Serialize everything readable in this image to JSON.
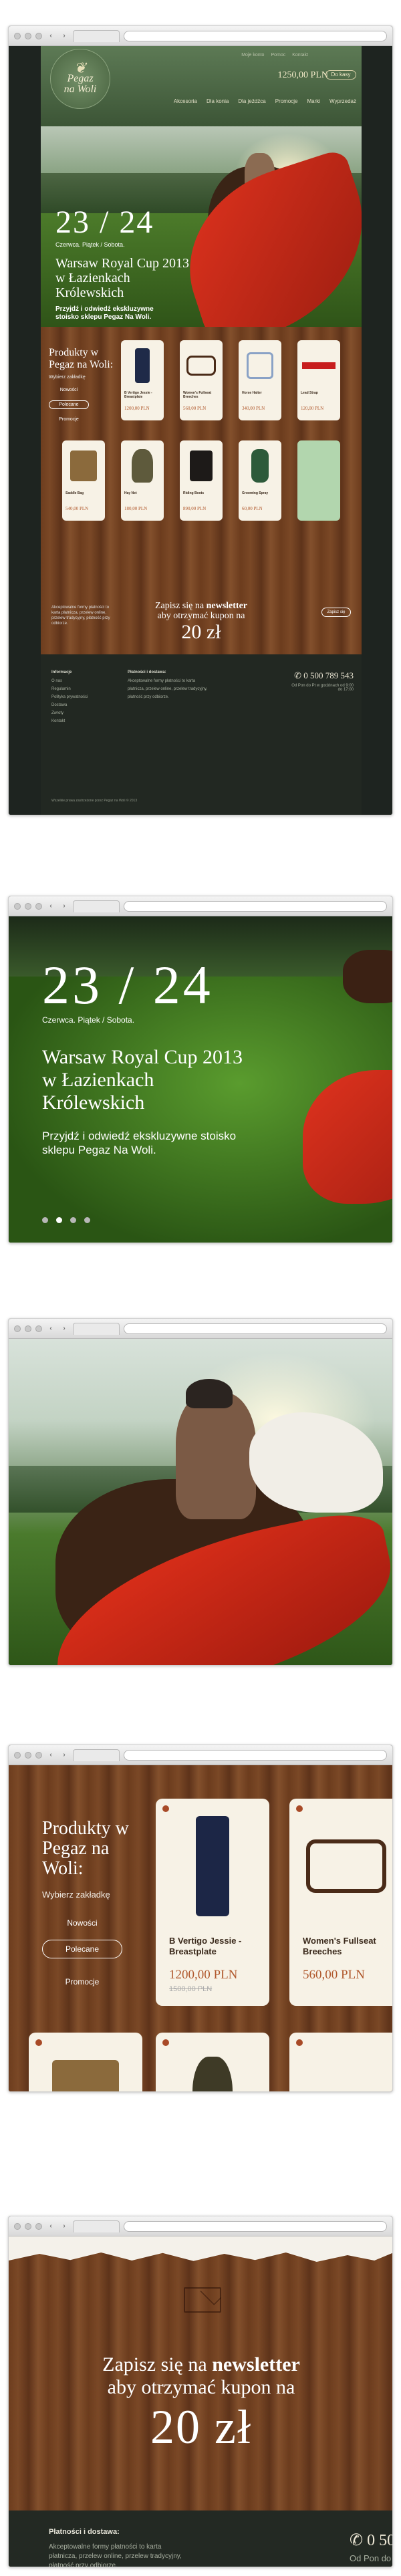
{
  "site": {
    "logo_lines": [
      "Pegaz",
      "na Woli"
    ],
    "cart_total": "1250,00 PLN",
    "cart_button": "Do kasy",
    "top_links": [
      "Moje konto",
      "Pomoc",
      "Kontakt"
    ],
    "nav": [
      "Akcesoria",
      "Dla konia",
      "Dla jeźdźca",
      "Promocje",
      "Marki",
      "Wyprzedaż"
    ]
  },
  "hero": {
    "date": "23 / 24",
    "date_sub": "Czerwca. Piątek / Sobota.",
    "title": "Warsaw Royal Cup 2013 w Łazienkach Królewskich",
    "description": "Przyjdź i odwiedź ekskluzywne stoisko sklepu Pegaz Na Woli.",
    "active_slide": 2,
    "slides": 4
  },
  "products": {
    "title": "Produkty w Pegaz na Woli:",
    "subtitle": "Wybierz zakładkę",
    "filters": [
      "Nowości",
      "Polecane",
      "Promocje"
    ],
    "active_filter": "Polecane",
    "items": [
      {
        "name": "B Vertigo Jessie - Breastplate",
        "price": "1200,00 PLN",
        "old_price": "1500,00 PLN",
        "icon": "breeches-icon"
      },
      {
        "name": "Women's Fullseat Breeches",
        "price": "560,00 PLN",
        "icon": "bridle-icon"
      },
      {
        "name": "Horse Halter",
        "price": "340,00 PLN",
        "icon": "halter-icon"
      },
      {
        "name": "Lead Strap",
        "price": "120,00 PLN",
        "icon": "strap-icon"
      },
      {
        "name": "Saddle Bag",
        "price": "540,00 PLN",
        "icon": "bag-icon"
      },
      {
        "name": "Hay Net",
        "price": "180,00 PLN",
        "icon": "net-icon"
      },
      {
        "name": "Riding Boots",
        "price": "890,00 PLN",
        "icon": "boots-icon"
      },
      {
        "name": "Grooming Spray",
        "price": "60,00 PLN",
        "icon": "bottle-icon"
      }
    ]
  },
  "newsletter": {
    "line1": "Zapisz się na",
    "line1_bold": "newsletter",
    "line2": "aby otrzymać kupon na",
    "amount": "20 zł",
    "button": "Zapisz się"
  },
  "footer": {
    "col1_title": "Informacje",
    "col1_items": [
      "O nas",
      "Regulamin",
      "Polityka prywatności",
      "Dostawa",
      "Zwroty",
      "Kontakt"
    ],
    "col2_title": "Płatności i dostawa:",
    "col2_text": "Akceptowalne formy płatności to karta płatnicza, przelew online, przelew tradycyjny, płatność przy odbiorze.",
    "phone": "0 500 789 543",
    "hours": "Od Pon do Pt w godzinach od 9:00 do 17:00",
    "copyright": "Wszelkie prawa zastrzeżone przez Pegaz na Woli © 2013"
  },
  "colors": {
    "accent": "#b0582c",
    "cape": "#e0331e",
    "footer": "#232923"
  }
}
